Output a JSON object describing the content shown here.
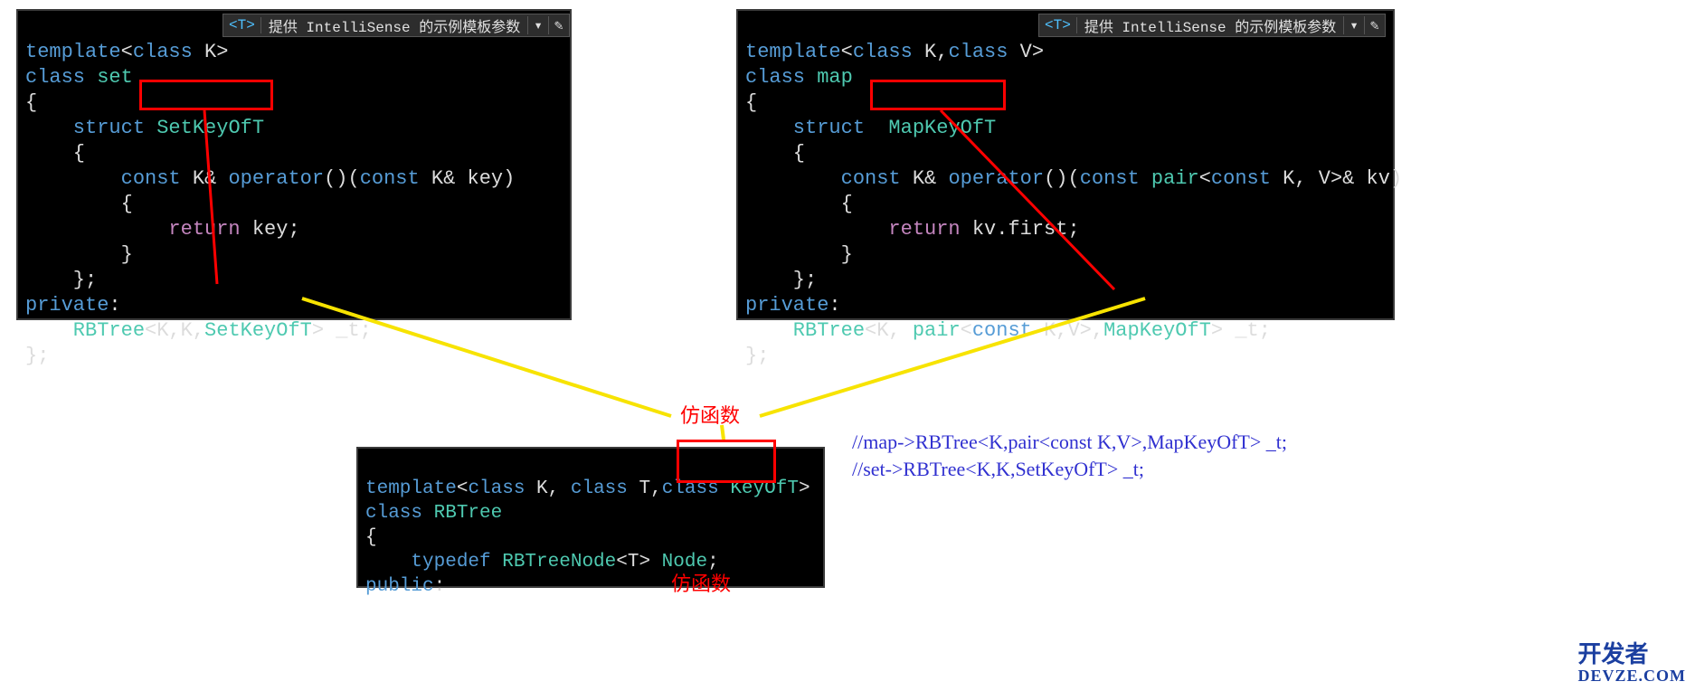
{
  "intellisense": {
    "tag": "<T>",
    "label": "提供 IntelliSense 的示例模板参数",
    "arrow": "▾",
    "pencil": "✎"
  },
  "left_code": {
    "l1a": "template",
    "l1b": "<",
    "l1c": "class",
    "l1d": " K>",
    "l2a": "class",
    "l2b": " set",
    "l3": "{",
    "l4a": "    struct",
    "l4b": " SetKeyOfT",
    "l5": "    {",
    "l6a": "        const",
    "l6b": " K& ",
    "l6c": "operator",
    "l6d": "()(",
    "l6e": "const",
    "l6f": " K& key)",
    "l7": "        {",
    "l8a": "            return",
    "l8b": " key;",
    "l9": "        }",
    "l10": "    };",
    "l11a": "private",
    "l11b": ":",
    "l12a": "    RBTree",
    "l12b": "<K,K,",
    "l12c": "SetKeyOfT",
    "l12d": "> _t;",
    "l13": "};"
  },
  "right_code": {
    "l1a": "template",
    "l1b": "<",
    "l1c": "class",
    "l1d": " K,",
    "l1e": "class",
    "l1f": " V>",
    "l2a": "class",
    "l2b": " map",
    "l3": "{",
    "l4a": "    struct",
    "l4b": "  MapKeyOfT",
    "l5": "    {",
    "l6a": "        const",
    "l6b": " K& ",
    "l6c": "operator",
    "l6d": "()(",
    "l6e": "const",
    "l6f": " pair",
    "l6g": "<",
    "l6h": "const",
    "l6i": " K, V>& kv)",
    "l7": "        {",
    "l8a": "            return",
    "l8b": " kv.first;",
    "l9": "        }",
    "l10": "    };",
    "l11a": "private",
    "l11b": ":",
    "l12a": "    RBTree",
    "l12b": "<K, ",
    "l12c": "pair",
    "l12d": "<",
    "l12e": "const",
    "l12f": " K,V>,",
    "l12g": "MapKeyOfT",
    "l12h": "> _t;",
    "l13": "};"
  },
  "bottom_code": {
    "l1a": "template",
    "l1b": "<",
    "l1c": "class",
    "l1d": " K, ",
    "l1e": "class",
    "l1f": " T,",
    "l1g": "class",
    "l1h": " KeyOfT",
    "l1i": ">",
    "l2a": "class",
    "l2b": " RBTree",
    "l3": "{",
    "l4a": "    typedef",
    "l4b": " RBTreeNode",
    "l4c": "<T> ",
    "l4d": "Node",
    "l4e": ";",
    "l5a": "public",
    "l5b": ":"
  },
  "annotations": {
    "functor_top": "仿函数",
    "functor_bottom": "仿函数"
  },
  "comments": {
    "line1": "//map->RBTree<K,pair<const K,V>,MapKeyOfT> _t;",
    "line2": "//set->RBTree<K,K,SetKeyOfT> _t;"
  },
  "watermark": {
    "top": "开发者",
    "bottom": "DEVZE.COM"
  }
}
